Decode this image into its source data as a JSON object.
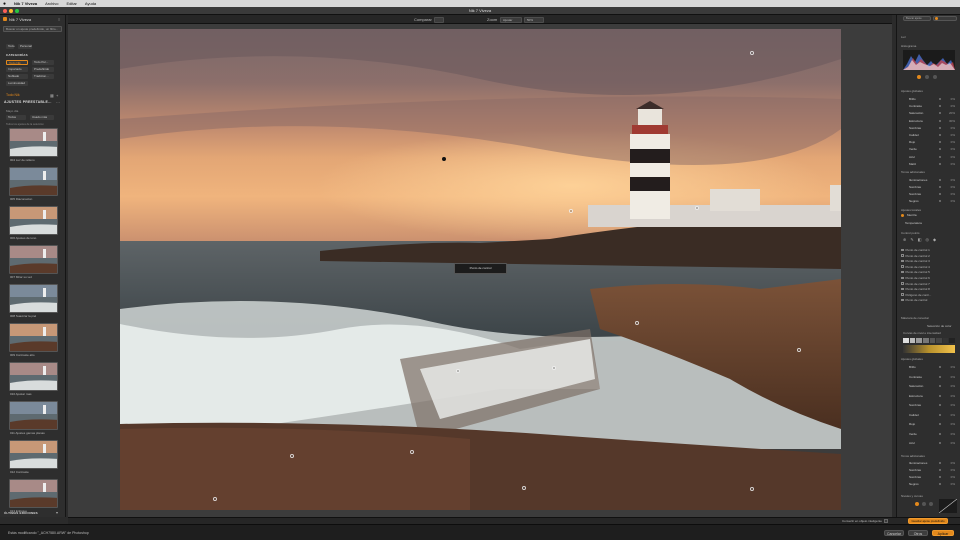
{
  "menubar": {
    "apple": "",
    "app": "Nik 7 Viveza",
    "items": [
      "Archivo",
      "Editar",
      "Ayuda"
    ]
  },
  "window": {
    "title": "Nik 7 Viveza"
  },
  "toolbar": {
    "compare_label": "Comparar",
    "zoom_label": "Zoom",
    "zoom_value": "Ajustar",
    "zoom_percent": "50%"
  },
  "left_panel": {
    "app_name": "Nik 7 Viveza",
    "search_placeholder": "Buscar un ajuste predefinido, un filtro...",
    "tabs": [
      "Todo",
      "Personal"
    ],
    "categories_header": "CATEGORÍAS",
    "categories": [
      "Todo Nik",
      "Todo Per...",
      "Importado",
      "Predefinido",
      "Nublado",
      "Tradicion...",
      "Luminosidad"
    ],
    "color_section": "Todo Nik",
    "presets_header": "AJUSTES PREESTABLE...",
    "sort_label": "Mayo día",
    "filter_options": [
      "Todos",
      "Usado más"
    ],
    "list_hint": "Todos los ajustes de la seleccion",
    "presets": [
      "004 Luz de relleno",
      "005 Diaconacion",
      "006 Ajustes de tono",
      "007 Mirar su vez",
      "008 Suavizar la piel",
      "009 Contraste alto",
      "010 Ajustar mas",
      "011 Ajustes gamas planas",
      "012 Contraste",
      "013 Enfoque"
    ],
    "recent_header": "ÚLTIMAS EDICIONES"
  },
  "photo": {
    "overlay_label": "Punto de control"
  },
  "right_panel": {
    "search_placeholder": "Buscar ajuste",
    "section_light": "Luz",
    "histogram_label": "Histograma",
    "global_adjustments": "Ajustes globales",
    "sliders": [
      {
        "name": "Brillo",
        "value": "0%"
      },
      {
        "name": "Contraste",
        "value": "0%"
      },
      {
        "name": "Saturación",
        "value": "20%"
      },
      {
        "name": "Estructura",
        "value": "30%"
      },
      {
        "name": "Sombras",
        "value": "0%"
      },
      {
        "name": "Calidez",
        "value": "0%"
      },
      {
        "name": "Rojo",
        "value": "0%"
      },
      {
        "name": "Verde",
        "value": "0%"
      },
      {
        "name": "Azul",
        "value": "0%"
      },
      {
        "name": "Matiz",
        "value": "0%"
      }
    ],
    "tonal_header": "Tonos adicionales",
    "tonal_sliders": [
      {
        "name": "Iluminaciones",
        "value": "0%"
      },
      {
        "name": "Sombras",
        "value": "0%"
      },
      {
        "name": "Sombras",
        "value": "0%"
      },
      {
        "name": "Negros",
        "value": "0%"
      }
    ],
    "local_header": "Ajustes locales",
    "mode_option": "Mezcla",
    "control_label": "Temperatura",
    "control_points_header": "Control points",
    "control_points": [
      "Punto de control 1",
      "Punto de control 2",
      "Punto de control 3",
      "Punto de control 4",
      "Punto de control 5",
      "Punto de control 6",
      "Punto de control 7",
      "Punto de control 8",
      "Polígono de contr...",
      "Punto de control"
    ],
    "masks_header": "Máscara de conectar",
    "selection_label": "Selección de color",
    "curve_header": "Curvas de nivel e intensidad",
    "lower_sliders": [
      {
        "name": "Brillo",
        "value": "0%"
      },
      {
        "name": "Contraste",
        "value": "0%"
      },
      {
        "name": "Saturación",
        "value": "0%"
      },
      {
        "name": "Estructura",
        "value": "0%"
      },
      {
        "name": "Sombras",
        "value": "0%"
      },
      {
        "name": "Calidez",
        "value": "0%"
      },
      {
        "name": "Rojo",
        "value": "0%"
      },
      {
        "name": "Verde",
        "value": "0%"
      },
      {
        "name": "Azul",
        "value": "0%"
      }
    ],
    "lower_tonal_header": "Tonos adicionales",
    "lower_tonal": [
      {
        "name": "Iluminaciones",
        "value": "0%"
      },
      {
        "name": "Sombras",
        "value": "0%"
      },
      {
        "name": "Sombras",
        "value": "0%"
      },
      {
        "name": "Negros",
        "value": "0%"
      }
    ],
    "levels_header": "Niveles y curvas"
  },
  "bottom_strip": {
    "smart_object_label": "Convertir en objeto inteligente",
    "save_preset_button": "Guardar ajuste predefinido"
  },
  "statusbar": {
    "message": "Estás modificando \"_ACH7580.ARW\" de Photoshop",
    "cancel_button": "Cancelar",
    "apply_hidden_button": "Otros",
    "apply_button": "Aplicar"
  },
  "colors": {
    "accent": "#e3891c",
    "panel": "#2e2e2e",
    "canvas": "#3c3c3c"
  }
}
